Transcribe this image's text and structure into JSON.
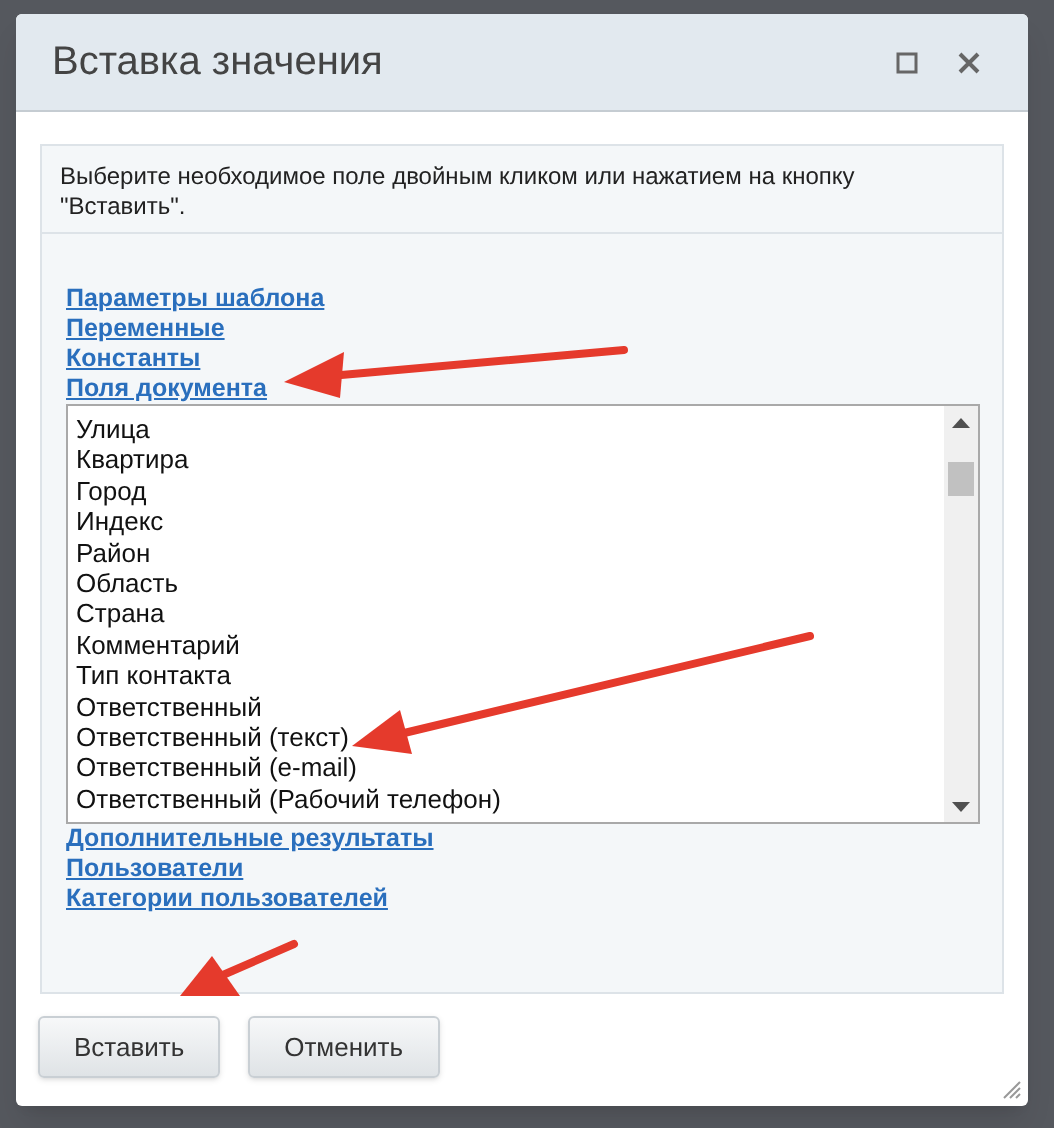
{
  "dialog": {
    "title": "Вставка значения"
  },
  "instruction": "Выберите необходимое поле двойным кликом или нажатием на кнопку \"Вставить\".",
  "links_top": [
    "Параметры шаблона",
    "Переменные",
    "Константы",
    "Поля документа"
  ],
  "field_list": {
    "items": [
      "Улица",
      "Квартира",
      "Город",
      "Индекс",
      "Район",
      "Область",
      "Страна",
      "Комментарий",
      "Тип контакта",
      "Ответственный",
      "Ответственный (текст)",
      "Ответственный (e-mail)",
      "Ответственный (Рабочий телефон)"
    ]
  },
  "links_bottom": [
    "Дополнительные результаты",
    "Пользователи",
    "Категории пользователей"
  ],
  "buttons": [
    "Вставить",
    "Отменить"
  ]
}
